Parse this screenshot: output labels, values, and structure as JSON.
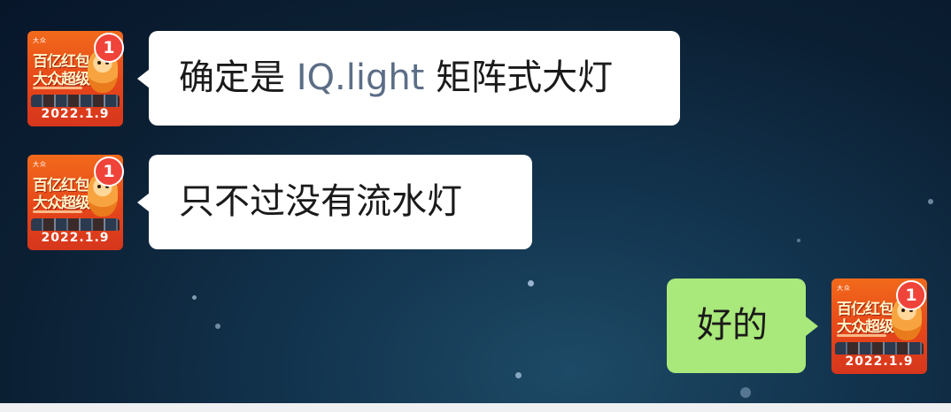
{
  "avatar": {
    "brand": "大众",
    "title_line1": "百亿红包",
    "title_line2": "大众超级",
    "date": "2022.1.9",
    "badge": "1"
  },
  "messages": [
    {
      "side": "left",
      "text_before": "确定是 ",
      "highlight": "IQ.light",
      "text_after": " 矩阵式大灯"
    },
    {
      "side": "left",
      "text": "只不过没有流水灯"
    },
    {
      "side": "right",
      "text": "好的"
    }
  ],
  "colors": {
    "incoming_bubble": "#ffffff",
    "outgoing_bubble": "#a9e87a",
    "badge": "#f0433a",
    "highlight_text": "#5c6d86"
  }
}
